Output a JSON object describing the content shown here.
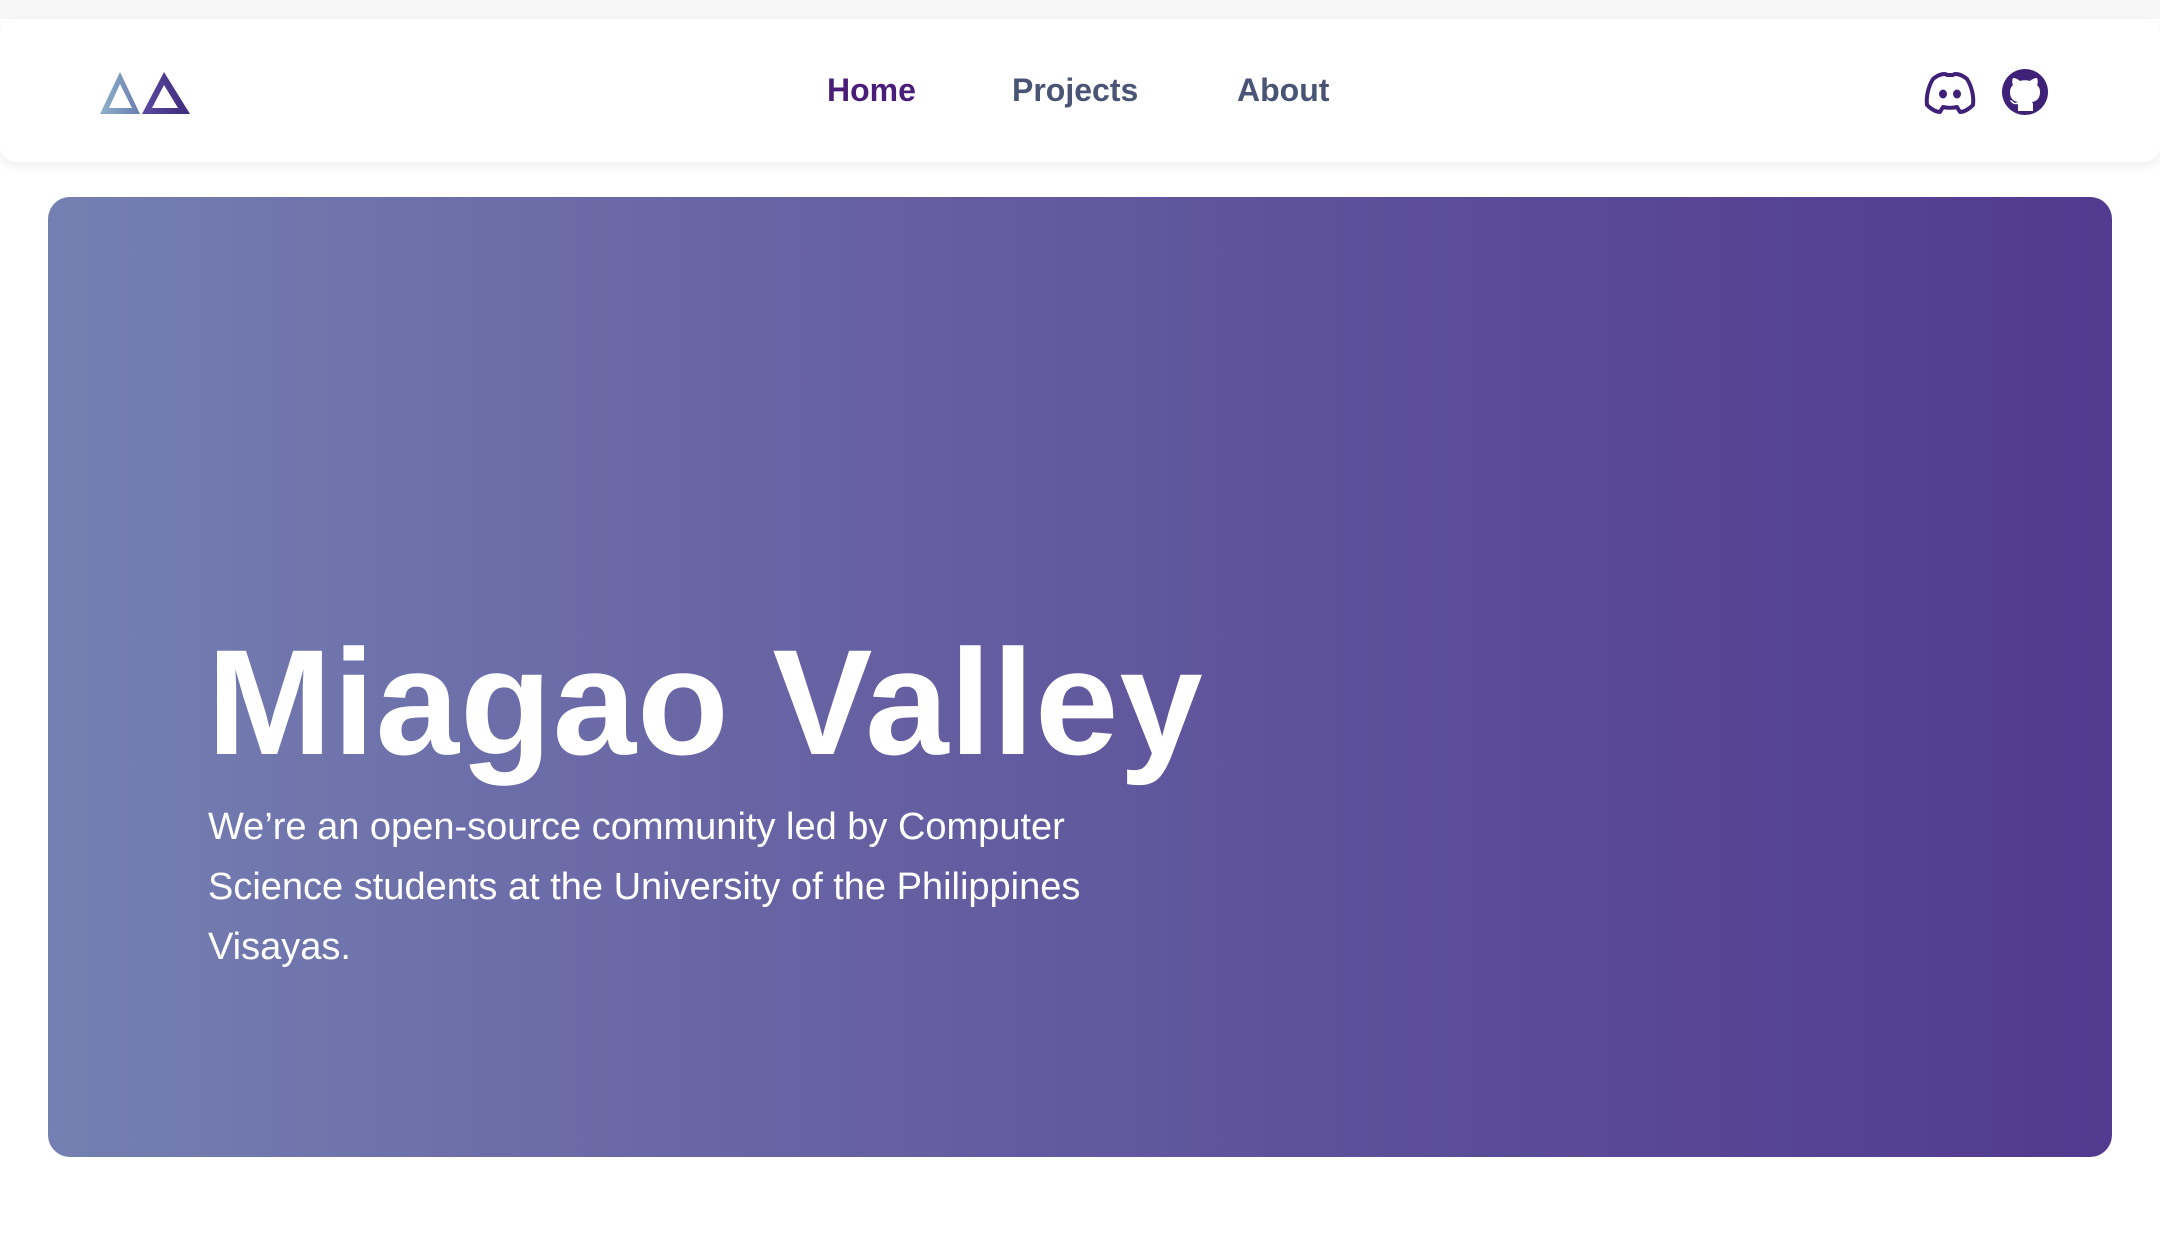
{
  "nav": {
    "links": [
      {
        "label": "Home"
      },
      {
        "label": "Projects"
      },
      {
        "label": "About"
      }
    ],
    "active_color": "#4a1d78",
    "link_color": "#4a5576"
  },
  "logo": {
    "icon": "mountain-triangles-logo"
  },
  "social": [
    {
      "icon": "discord-icon"
    },
    {
      "icon": "github-icon"
    }
  ],
  "hero": {
    "title": "Miagao Valley",
    "description": "We’re an open-source community led by Computer Science students at the University of the Philippines Visayas.",
    "gradient": [
      "#7480b1",
      "#523a8f"
    ]
  }
}
